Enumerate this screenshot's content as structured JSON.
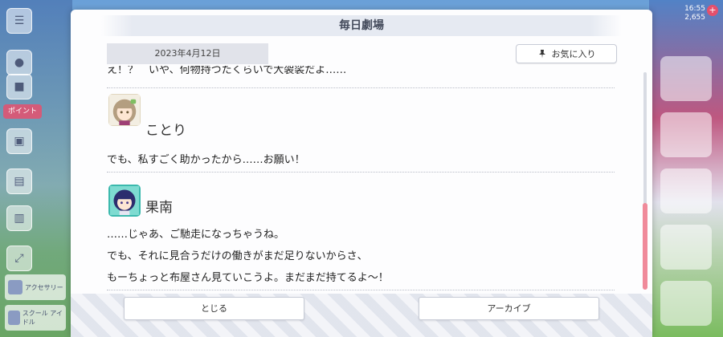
{
  "dialog": {
    "title": "毎日劇場",
    "date": "2023年4月12日",
    "favorite_label": "お気に入り",
    "close_label": "とじる",
    "archive_label": "アーカイブ"
  },
  "script": {
    "truncated_line": "え！？　いや、何物持つたくらいで大袈裟だよ……",
    "entries": [
      {
        "speaker": "ことり",
        "lines": [
          "でも、私すごく助かったから……お願い！"
        ]
      },
      {
        "speaker": "果南",
        "lines": [
          "……じゃあ、ご馳走になっちゃうね。",
          "でも、それに見合うだけの働きがまだ足りないからさ、",
          "もーちょっと布屋さん見ていこうよ。まだまだ持てるよ～！"
        ]
      }
    ]
  },
  "background": {
    "side_label": "ポイント",
    "chips": [
      "アクセサリー",
      "スクール アイドル"
    ],
    "top_info": [
      "16:55",
      "2,655"
    ]
  },
  "colors": {
    "scroll_thumb": "#f08a9a",
    "accent": "#e4506c"
  }
}
